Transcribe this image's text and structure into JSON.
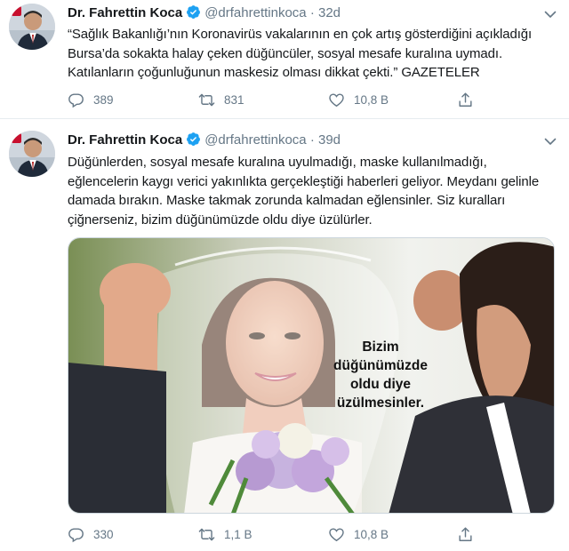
{
  "tweets": [
    {
      "author": {
        "name": "Dr. Fahrettin Koca",
        "handle": "@drfahrettinkoca",
        "separator": "·",
        "time": "32d"
      },
      "text": "“Sağlık Bakanlığı’nın Koronavirüs vakalarının en çok artış gösterdiğini açıkladığı Bursa’da sokakta halay çeken düğüncüler, sosyal mesafe kuralına uymadı. Katılanların çoğunluğunun maskesiz olması dikkat çekti.” GAZETELER",
      "stats": {
        "replies": "389",
        "retweets": "831",
        "likes": "10,8 B"
      }
    },
    {
      "author": {
        "name": "Dr. Fahrettin Koca",
        "handle": "@drfahrettinkoca",
        "separator": "·",
        "time": "39d"
      },
      "text": "Düğünlerden, sosyal mesafe kuralına uyulmadığı, maske kullanılmadığı, eğlencelerin kaygı verici yakınlıkta gerçekleştiği haberleri geliyor. Meydanı gelinle damada bırakın. Maske takmak zorunda kalmadan eğlensinler. Siz kuralları çiğnerseniz, bizim düğünümüzde oldu diye üzülürler.",
      "media_caption": "Bizim düğünümüzde oldu diye üzülmesinler.",
      "stats": {
        "replies": "330",
        "retweets": "1,1 B",
        "likes": "10,8 B"
      }
    }
  ],
  "icons": {
    "verified": "verified-badge-icon",
    "more": "chevron-down-icon",
    "reply": "reply-icon",
    "retweet": "retweet-icon",
    "like": "heart-icon",
    "share": "share-icon"
  },
  "colors": {
    "verified": "#1da1f2",
    "secondary_text": "#657786",
    "primary_text": "#14171a",
    "divider": "#e6ecf0"
  }
}
